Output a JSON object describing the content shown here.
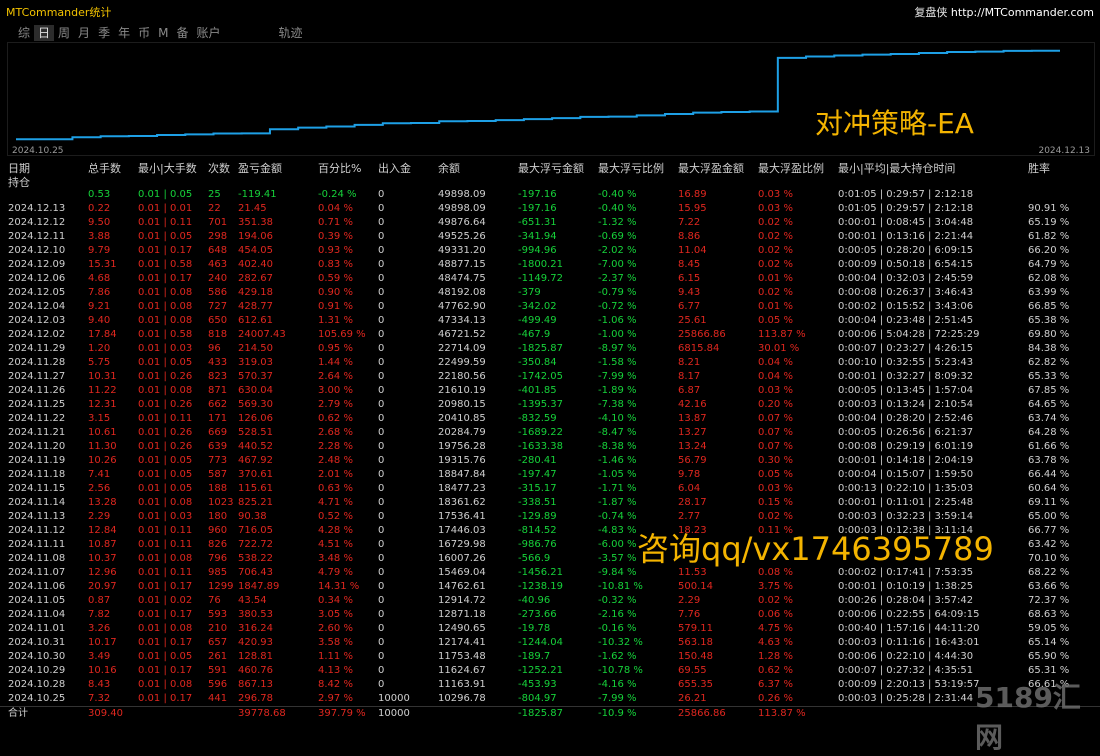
{
  "app": {
    "title": "MTCommander统计",
    "brand_prefix": "复盘侠",
    "brand_url": "http://MTCommander.com"
  },
  "tabs": [
    {
      "label": "综",
      "active": false
    },
    {
      "label": "日",
      "active": true
    },
    {
      "label": "周",
      "active": false
    },
    {
      "label": "月",
      "active": false
    },
    {
      "label": "季",
      "active": false
    },
    {
      "label": "年",
      "active": false
    },
    {
      "label": "币",
      "active": false
    },
    {
      "label": "M",
      "active": false
    },
    {
      "label": "备",
      "active": false
    },
    {
      "label": "账户",
      "active": false
    },
    {
      "label": "轨迹",
      "active": false
    }
  ],
  "equity_chart": {
    "start_label": "2024.10.25",
    "end_label": "2024.12.13",
    "line_color": "#1ea0e6",
    "balance_series": [
      10296.78,
      10296.78,
      11163.91,
      11624.67,
      11753.48,
      12174.41,
      12490.65,
      12871.18,
      12914.72,
      14762.61,
      15469.04,
      16007.26,
      16729.98,
      17446.03,
      17536.41,
      18361.62,
      18477.23,
      18847.84,
      19315.76,
      19756.28,
      20284.79,
      20410.85,
      20980.15,
      21610.19,
      22180.56,
      22499.59,
      22714.09,
      46721.52,
      47334.13,
      47762.9,
      48192.08,
      48474.75,
      48877.15,
      49331.2,
      49525.26,
      49876.64,
      49898.09,
      49898.09
    ]
  },
  "watermarks": {
    "strategy": "对冲策略-EA",
    "contact": "咨询qq/vx1746395789",
    "site": "5189汇网"
  },
  "table": {
    "headers": {
      "date_l1": "日期",
      "date_l2": "持仓",
      "lots": "总手数",
      "minmax": "最小|大手数",
      "count": "次数",
      "pnl": "盈亏金额",
      "pct": "百分比%",
      "deposit": "出入金",
      "balance": "余额",
      "max_dd": "最大浮亏金额",
      "max_dd_pct": "最大浮亏比例",
      "max_fe": "最大浮盈金额",
      "max_fe_pct": "最大浮盈比例",
      "hold_time": "最小|平均|最大持仓时间",
      "win_rate": "胜率"
    },
    "holding": {
      "date": "",
      "lots": "0.53",
      "minmax": "0.01 | 0.05",
      "count": "25",
      "pnl": "-119.41",
      "pct": "-0.24 %",
      "deposit": "0",
      "balance": "49898.09",
      "max_dd": "-197.16",
      "max_dd_pct": "-0.40 %",
      "max_fe": "16.89",
      "max_fe_pct": "0.03 %",
      "hold_time": "0:01:05 | 0:29:57 | 2:12:18",
      "win_rate": ""
    },
    "rows": [
      {
        "date": "2024.12.13",
        "lots": "0.22",
        "minmax": "0.01 | 0.01",
        "count": "22",
        "pnl": "21.45",
        "pct": "0.04 %",
        "deposit": "0",
        "balance": "49898.09",
        "max_dd": "-197.16",
        "max_dd_pct": "-0.40 %",
        "max_fe": "15.95",
        "max_fe_pct": "0.03 %",
        "hold_time": "0:01:05 | 0:29:57 | 2:12:18",
        "win_rate": "90.91 %"
      },
      {
        "date": "2024.12.12",
        "lots": "9.50",
        "minmax": "0.01 | 0.11",
        "count": "701",
        "pnl": "351.38",
        "pct": "0.71 %",
        "deposit": "0",
        "balance": "49876.64",
        "max_dd": "-651.31",
        "max_dd_pct": "-1.32 %",
        "max_fe": "7.22",
        "max_fe_pct": "0.02 %",
        "hold_time": "0:00:01 | 0:08:45 | 3:04:48",
        "win_rate": "65.19 %"
      },
      {
        "date": "2024.12.11",
        "lots": "3.88",
        "minmax": "0.01 | 0.05",
        "count": "298",
        "pnl": "194.06",
        "pct": "0.39 %",
        "deposit": "0",
        "balance": "49525.26",
        "max_dd": "-341.94",
        "max_dd_pct": "-0.69 %",
        "max_fe": "8.86",
        "max_fe_pct": "0.02 %",
        "hold_time": "0:00:01 | 0:13:16 | 2:21:44",
        "win_rate": "61.82 %"
      },
      {
        "date": "2024.12.10",
        "lots": "9.79",
        "minmax": "0.01 | 0.17",
        "count": "648",
        "pnl": "454.05",
        "pct": "0.93 %",
        "deposit": "0",
        "balance": "49331.20",
        "max_dd": "-994.96",
        "max_dd_pct": "-2.02 %",
        "max_fe": "11.04",
        "max_fe_pct": "0.02 %",
        "hold_time": "0:00:05 | 0:28:20 | 6:09:15",
        "win_rate": "66.20 %"
      },
      {
        "date": "2024.12.09",
        "lots": "15.31",
        "minmax": "0.01 | 0.58",
        "count": "463",
        "pnl": "402.40",
        "pct": "0.83 %",
        "deposit": "0",
        "balance": "48877.15",
        "max_dd": "-1800.21",
        "max_dd_pct": "-7.00 %",
        "max_fe": "8.45",
        "max_fe_pct": "0.02 %",
        "hold_time": "0:00:09 | 0:50:18 | 6:54:15",
        "win_rate": "64.79 %"
      },
      {
        "date": "2024.12.06",
        "lots": "4.68",
        "minmax": "0.01 | 0.17",
        "count": "240",
        "pnl": "282.67",
        "pct": "0.59 %",
        "deposit": "0",
        "balance": "48474.75",
        "max_dd": "-1149.72",
        "max_dd_pct": "-2.37 %",
        "max_fe": "6.15",
        "max_fe_pct": "0.01 %",
        "hold_time": "0:00:04 | 0:32:03 | 2:45:59",
        "win_rate": "62.08 %"
      },
      {
        "date": "2024.12.05",
        "lots": "7.86",
        "minmax": "0.01 | 0.08",
        "count": "586",
        "pnl": "429.18",
        "pct": "0.90 %",
        "deposit": "0",
        "balance": "48192.08",
        "max_dd": "-379",
        "max_dd_pct": "-0.79 %",
        "max_fe": "9.43",
        "max_fe_pct": "0.02 %",
        "hold_time": "0:00:08 | 0:26:37 | 3:46:43",
        "win_rate": "63.99 %"
      },
      {
        "date": "2024.12.04",
        "lots": "9.21",
        "minmax": "0.01 | 0.08",
        "count": "727",
        "pnl": "428.77",
        "pct": "0.91 %",
        "deposit": "0",
        "balance": "47762.90",
        "max_dd": "-342.02",
        "max_dd_pct": "-0.72 %",
        "max_fe": "6.77",
        "max_fe_pct": "0.01 %",
        "hold_time": "0:00:02 | 0:15:52 | 3:43:06",
        "win_rate": "66.85 %"
      },
      {
        "date": "2024.12.03",
        "lots": "9.40",
        "minmax": "0.01 | 0.08",
        "count": "650",
        "pnl": "612.61",
        "pct": "1.31 %",
        "deposit": "0",
        "balance": "47334.13",
        "max_dd": "-499.49",
        "max_dd_pct": "-1.06 %",
        "max_fe": "25.61",
        "max_fe_pct": "0.05 %",
        "hold_time": "0:00:04 | 0:23:48 | 2:51:45",
        "win_rate": "65.38 %"
      },
      {
        "date": "2024.12.02",
        "lots": "17.84",
        "minmax": "0.01 | 0.58",
        "count": "818",
        "pnl": "24007.43",
        "pct": "105.69 %",
        "deposit": "0",
        "balance": "46721.52",
        "max_dd": "-467.9",
        "max_dd_pct": "-1.00 %",
        "max_fe": "25866.86",
        "max_fe_pct": "113.87 %",
        "hold_time": "0:00:06 | 5:04:28 | 72:25:29",
        "win_rate": "69.80 %"
      },
      {
        "date": "2024.11.29",
        "lots": "1.20",
        "minmax": "0.01 | 0.03",
        "count": "96",
        "pnl": "214.50",
        "pct": "0.95 %",
        "deposit": "0",
        "balance": "22714.09",
        "max_dd": "-1825.87",
        "max_dd_pct": "-8.97 %",
        "max_fe": "6815.84",
        "max_fe_pct": "30.01 %",
        "hold_time": "0:00:07 | 0:23:27 | 4:26:15",
        "win_rate": "84.38 %"
      },
      {
        "date": "2024.11.28",
        "lots": "5.75",
        "minmax": "0.01 | 0.05",
        "count": "433",
        "pnl": "319.03",
        "pct": "1.44 %",
        "deposit": "0",
        "balance": "22499.59",
        "max_dd": "-350.84",
        "max_dd_pct": "-1.58 %",
        "max_fe": "8.21",
        "max_fe_pct": "0.04 %",
        "hold_time": "0:00:10 | 0:32:55 | 5:23:43",
        "win_rate": "62.82 %"
      },
      {
        "date": "2024.11.27",
        "lots": "10.31",
        "minmax": "0.01 | 0.26",
        "count": "823",
        "pnl": "570.37",
        "pct": "2.64 %",
        "deposit": "0",
        "balance": "22180.56",
        "max_dd": "-1742.05",
        "max_dd_pct": "-7.99 %",
        "max_fe": "8.17",
        "max_fe_pct": "0.04 %",
        "hold_time": "0:00:01 | 0:32:27 | 8:09:32",
        "win_rate": "65.33 %"
      },
      {
        "date": "2024.11.26",
        "lots": "11.22",
        "minmax": "0.01 | 0.08",
        "count": "871",
        "pnl": "630.04",
        "pct": "3.00 %",
        "deposit": "0",
        "balance": "21610.19",
        "max_dd": "-401.85",
        "max_dd_pct": "-1.89 %",
        "max_fe": "6.87",
        "max_fe_pct": "0.03 %",
        "hold_time": "0:00:05 | 0:13:45 | 1:57:04",
        "win_rate": "67.85 %"
      },
      {
        "date": "2024.11.25",
        "lots": "12.31",
        "minmax": "0.01 | 0.26",
        "count": "662",
        "pnl": "569.30",
        "pct": "2.79 %",
        "deposit": "0",
        "balance": "20980.15",
        "max_dd": "-1395.37",
        "max_dd_pct": "-7.38 %",
        "max_fe": "42.16",
        "max_fe_pct": "0.20 %",
        "hold_time": "0:00:03 | 0:13:24 | 2:10:54",
        "win_rate": "64.65 %"
      },
      {
        "date": "2024.11.22",
        "lots": "3.15",
        "minmax": "0.01 | 0.11",
        "count": "171",
        "pnl": "126.06",
        "pct": "0.62 %",
        "deposit": "0",
        "balance": "20410.85",
        "max_dd": "-832.59",
        "max_dd_pct": "-4.10 %",
        "max_fe": "13.87",
        "max_fe_pct": "0.07 %",
        "hold_time": "0:00:04 | 0:28:20 | 2:52:46",
        "win_rate": "63.74 %"
      },
      {
        "date": "2024.11.21",
        "lots": "10.61",
        "minmax": "0.01 | 0.26",
        "count": "669",
        "pnl": "528.51",
        "pct": "2.68 %",
        "deposit": "0",
        "balance": "20284.79",
        "max_dd": "-1689.22",
        "max_dd_pct": "-8.47 %",
        "max_fe": "13.27",
        "max_fe_pct": "0.07 %",
        "hold_time": "0:00:05 | 0:26:56 | 6:21:37",
        "win_rate": "64.28 %"
      },
      {
        "date": "2024.11.20",
        "lots": "11.30",
        "minmax": "0.01 | 0.26",
        "count": "639",
        "pnl": "440.52",
        "pct": "2.28 %",
        "deposit": "0",
        "balance": "19756.28",
        "max_dd": "-1633.38",
        "max_dd_pct": "-8.38 %",
        "max_fe": "13.24",
        "max_fe_pct": "0.07 %",
        "hold_time": "0:00:08 | 0:29:19 | 6:01:19",
        "win_rate": "61.66 %"
      },
      {
        "date": "2024.11.19",
        "lots": "10.26",
        "minmax": "0.01 | 0.05",
        "count": "773",
        "pnl": "467.92",
        "pct": "2.48 %",
        "deposit": "0",
        "balance": "19315.76",
        "max_dd": "-280.41",
        "max_dd_pct": "-1.46 %",
        "max_fe": "56.79",
        "max_fe_pct": "0.30 %",
        "hold_time": "0:00:01 | 0:14:18 | 2:04:19",
        "win_rate": "63.78 %"
      },
      {
        "date": "2024.11.18",
        "lots": "7.41",
        "minmax": "0.01 | 0.05",
        "count": "587",
        "pnl": "370.61",
        "pct": "2.01 %",
        "deposit": "0",
        "balance": "18847.84",
        "max_dd": "-197.47",
        "max_dd_pct": "-1.05 %",
        "max_fe": "9.78",
        "max_fe_pct": "0.05 %",
        "hold_time": "0:00:04 | 0:15:07 | 1:59:50",
        "win_rate": "66.44 %"
      },
      {
        "date": "2024.11.15",
        "lots": "2.56",
        "minmax": "0.01 | 0.05",
        "count": "188",
        "pnl": "115.61",
        "pct": "0.63 %",
        "deposit": "0",
        "balance": "18477.23",
        "max_dd": "-315.17",
        "max_dd_pct": "-1.71 %",
        "max_fe": "6.04",
        "max_fe_pct": "0.03 %",
        "hold_time": "0:00:13 | 0:22:10 | 1:35:03",
        "win_rate": "60.64 %"
      },
      {
        "date": "2024.11.14",
        "lots": "13.28",
        "minmax": "0.01 | 0.08",
        "count": "1023",
        "pnl": "825.21",
        "pct": "4.71 %",
        "deposit": "0",
        "balance": "18361.62",
        "max_dd": "-338.51",
        "max_dd_pct": "-1.87 %",
        "max_fe": "28.17",
        "max_fe_pct": "0.15 %",
        "hold_time": "0:00:01 | 0:11:01 | 2:25:48",
        "win_rate": "69.11 %"
      },
      {
        "date": "2024.11.13",
        "lots": "2.29",
        "minmax": "0.01 | 0.03",
        "count": "180",
        "pnl": "90.38",
        "pct": "0.52 %",
        "deposit": "0",
        "balance": "17536.41",
        "max_dd": "-129.89",
        "max_dd_pct": "-0.74 %",
        "max_fe": "2.77",
        "max_fe_pct": "0.02 %",
        "hold_time": "0:00:03 | 0:32:23 | 3:59:14",
        "win_rate": "65.00 %"
      },
      {
        "date": "2024.11.12",
        "lots": "12.84",
        "minmax": "0.01 | 0.11",
        "count": "960",
        "pnl": "716.05",
        "pct": "4.28 %",
        "deposit": "0",
        "balance": "17446.03",
        "max_dd": "-814.52",
        "max_dd_pct": "-4.83 %",
        "max_fe": "18.23",
        "max_fe_pct": "0.11 %",
        "hold_time": "0:00:03 | 0:12:38 | 3:11:14",
        "win_rate": "66.77 %"
      },
      {
        "date": "2024.11.11",
        "lots": "10.87",
        "minmax": "0.01 | 0.11",
        "count": "826",
        "pnl": "722.72",
        "pct": "4.51 %",
        "deposit": "0",
        "balance": "16729.98",
        "max_dd": "-986.76",
        "max_dd_pct": "-6.00 %",
        "max_fe": "",
        "max_fe_pct": "",
        "hold_time": "",
        "win_rate": "63.42 %"
      },
      {
        "date": "2024.11.08",
        "lots": "10.37",
        "minmax": "0.01 | 0.08",
        "count": "796",
        "pnl": "538.22",
        "pct": "3.48 %",
        "deposit": "0",
        "balance": "16007.26",
        "max_dd": "-566.9",
        "max_dd_pct": "-3.57 %",
        "max_fe": "",
        "max_fe_pct": "",
        "hold_time": "",
        "win_rate": "70.10 %"
      },
      {
        "date": "2024.11.07",
        "lots": "12.96",
        "minmax": "0.01 | 0.11",
        "count": "985",
        "pnl": "706.43",
        "pct": "4.79 %",
        "deposit": "0",
        "balance": "15469.04",
        "max_dd": "-1456.21",
        "max_dd_pct": "-9.84 %",
        "max_fe": "11.53",
        "max_fe_pct": "0.08 %",
        "hold_time": "0:00:02 | 0:17:41 | 7:53:35",
        "win_rate": "68.22 %"
      },
      {
        "date": "2024.11.06",
        "lots": "20.97",
        "minmax": "0.01 | 0.17",
        "count": "1299",
        "pnl": "1847.89",
        "pct": "14.31 %",
        "deposit": "0",
        "balance": "14762.61",
        "max_dd": "-1238.19",
        "max_dd_pct": "-10.81 %",
        "max_fe": "500.14",
        "max_fe_pct": "3.75 %",
        "hold_time": "0:00:01 | 0:10:19 | 1:38:25",
        "win_rate": "63.66 %"
      },
      {
        "date": "2024.11.05",
        "lots": "0.87",
        "minmax": "0.01 | 0.02",
        "count": "76",
        "pnl": "43.54",
        "pct": "0.34 %",
        "deposit": "0",
        "balance": "12914.72",
        "max_dd": "-40.96",
        "max_dd_pct": "-0.32 %",
        "max_fe": "2.29",
        "max_fe_pct": "0.02 %",
        "hold_time": "0:00:26 | 0:28:04 | 3:57:42",
        "win_rate": "72.37 %"
      },
      {
        "date": "2024.11.04",
        "lots": "7.82",
        "minmax": "0.01 | 0.17",
        "count": "593",
        "pnl": "380.53",
        "pct": "3.05 %",
        "deposit": "0",
        "balance": "12871.18",
        "max_dd": "-273.66",
        "max_dd_pct": "-2.16 %",
        "max_fe": "7.76",
        "max_fe_pct": "0.06 %",
        "hold_time": "0:00:06 | 0:22:55 | 64:09:15",
        "win_rate": "68.63 %"
      },
      {
        "date": "2024.11.01",
        "lots": "3.26",
        "minmax": "0.01 | 0.08",
        "count": "210",
        "pnl": "316.24",
        "pct": "2.60 %",
        "deposit": "0",
        "balance": "12490.65",
        "max_dd": "-19.78",
        "max_dd_pct": "-0.16 %",
        "max_fe": "579.11",
        "max_fe_pct": "4.75 %",
        "hold_time": "0:00:40 | 1:57:16 | 44:11:20",
        "win_rate": "59.05 %"
      },
      {
        "date": "2024.10.31",
        "lots": "10.17",
        "minmax": "0.01 | 0.17",
        "count": "657",
        "pnl": "420.93",
        "pct": "3.58 %",
        "deposit": "0",
        "balance": "12174.41",
        "max_dd": "-1244.04",
        "max_dd_pct": "-10.32 %",
        "max_fe": "563.18",
        "max_fe_pct": "4.63 %",
        "hold_time": "0:00:03 | 0:11:16 | 16:43:01",
        "win_rate": "65.14 %"
      },
      {
        "date": "2024.10.30",
        "lots": "3.49",
        "minmax": "0.01 | 0.05",
        "count": "261",
        "pnl": "128.81",
        "pct": "1.11 %",
        "deposit": "0",
        "balance": "11753.48",
        "max_dd": "-189.7",
        "max_dd_pct": "-1.62 %",
        "max_fe": "150.48",
        "max_fe_pct": "1.28 %",
        "hold_time": "0:00:06 | 0:22:10 | 4:44:30",
        "win_rate": "65.90 %"
      },
      {
        "date": "2024.10.29",
        "lots": "10.16",
        "minmax": "0.01 | 0.17",
        "count": "591",
        "pnl": "460.76",
        "pct": "4.13 %",
        "deposit": "0",
        "balance": "11624.67",
        "max_dd": "-1252.21",
        "max_dd_pct": "-10.78 %",
        "max_fe": "69.55",
        "max_fe_pct": "0.62 %",
        "hold_time": "0:00:07 | 0:27:32 | 4:35:51",
        "win_rate": "65.31 %"
      },
      {
        "date": "2024.10.28",
        "lots": "8.43",
        "minmax": "0.01 | 0.08",
        "count": "596",
        "pnl": "867.13",
        "pct": "8.42 %",
        "deposit": "0",
        "balance": "11163.91",
        "max_dd": "-453.93",
        "max_dd_pct": "-4.16 %",
        "max_fe": "655.35",
        "max_fe_pct": "6.37 %",
        "hold_time": "0:00:09 | 2:20:13 | 53:19:57",
        "win_rate": "66.61 %"
      },
      {
        "date": "2024.10.25",
        "lots": "7.32",
        "minmax": "0.01 | 0.17",
        "count": "441",
        "pnl": "296.78",
        "pct": "2.97 %",
        "deposit": "10000",
        "balance": "10296.78",
        "max_dd": "-804.97",
        "max_dd_pct": "-7.99 %",
        "max_fe": "26.21",
        "max_fe_pct": "0.26 %",
        "hold_time": "0:00:03 | 0:25:28 | 2:31:44",
        "win_rate": ""
      }
    ],
    "total": {
      "date": "合计",
      "lots": "309.40",
      "minmax": "",
      "count": "",
      "pnl": "39778.68",
      "pct": "397.79 %",
      "deposit": "10000",
      "balance": "",
      "max_dd": "-1825.87",
      "max_dd_pct": "-10.9 %",
      "max_fe": "25866.86",
      "max_fe_pct": "113.87 %",
      "hold_time": "",
      "win_rate": ""
    },
    "colors": {
      "positive": "#e0271f",
      "negative": "#16d23a",
      "neutral": "#cfcfcf"
    }
  }
}
